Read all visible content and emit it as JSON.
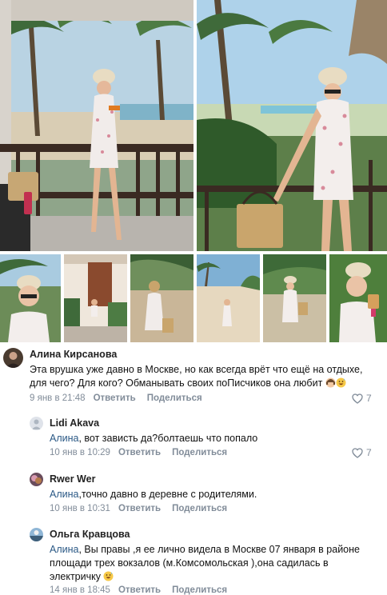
{
  "comments": [
    {
      "author": "Алина Кирсанова",
      "text": "Эта врушка уже давно в Москве, но как всегда врёт что ещё на отдыхе, для чего? Для кого? Обманывать своих поПисчиков она любит",
      "emoji_icons": [
        "woman-facepalming-emoji",
        "grinning-sweat-emoji"
      ],
      "date": "9 янв в 21:48",
      "reply_label": "Ответить",
      "share_label": "Поделиться",
      "likes": "7"
    },
    {
      "author": "Lidi Akava",
      "reply_to": "Алина",
      "text": ", вот зависть да?болтаешь что попало",
      "date": "10 янв в 10:29",
      "reply_label": "Ответить",
      "share_label": "Поделиться",
      "likes": "7"
    },
    {
      "author": "Rwer Wer",
      "reply_to": "Алина",
      "text": ",точно давно в деревне с родителями.",
      "date": "10 янв в 10:31",
      "reply_label": "Ответить",
      "share_label": "Поделиться"
    },
    {
      "author": "Ольга Кравцова",
      "reply_to": "Алина",
      "text": ", Вы правы ,я ее лично видела в Москве 07 января в районе площади трех вокзалов (м.Комсомольская ),она садилась в электричку",
      "emoji_icons": [
        "grinning-sweat-emoji"
      ],
      "date": "14 янв в 18:45",
      "reply_label": "Ответить",
      "share_label": "Поделиться"
    }
  ],
  "colors": {
    "link": "#2a5885",
    "meta": "#818c99",
    "name": "#222222"
  }
}
